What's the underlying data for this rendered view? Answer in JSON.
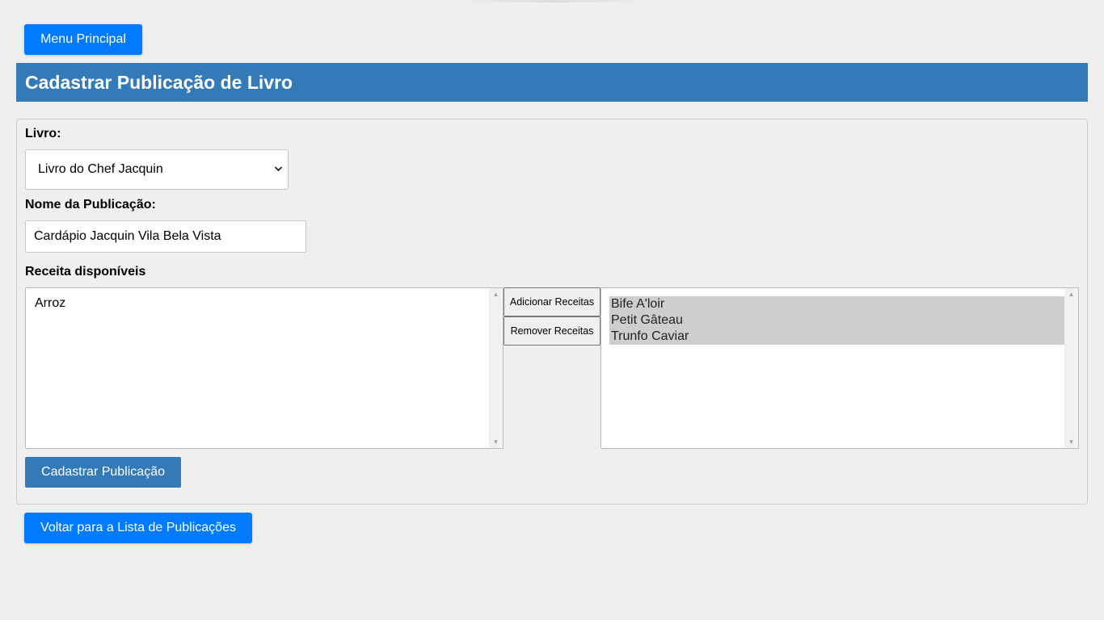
{
  "nav": {
    "menu_label": "Menu Principal",
    "back_label": "Voltar para a Lista de Publicações"
  },
  "header": {
    "title": "Cadastrar Publicação de Livro"
  },
  "form": {
    "livro_label": "Livro:",
    "livro_selected": "Livro do Chef Jacquin",
    "nome_label": "Nome da Publicação:",
    "nome_value": "Cardápio Jacquin Vila Bela Vista",
    "receitas_label": "Receita disponíveis",
    "available_recipes": [
      "Arroz"
    ],
    "selected_recipes": [
      "Bife A'loir",
      "Petit Gâteau",
      "Trunfo Caviar"
    ],
    "add_label": "Adicionar Receitas",
    "remove_label": "Remover Receitas",
    "submit_label": "Cadastrar Publicação"
  },
  "colors": {
    "primary_button": "#007bff",
    "header_bg": "#337ab7",
    "page_bg": "#efefef"
  }
}
